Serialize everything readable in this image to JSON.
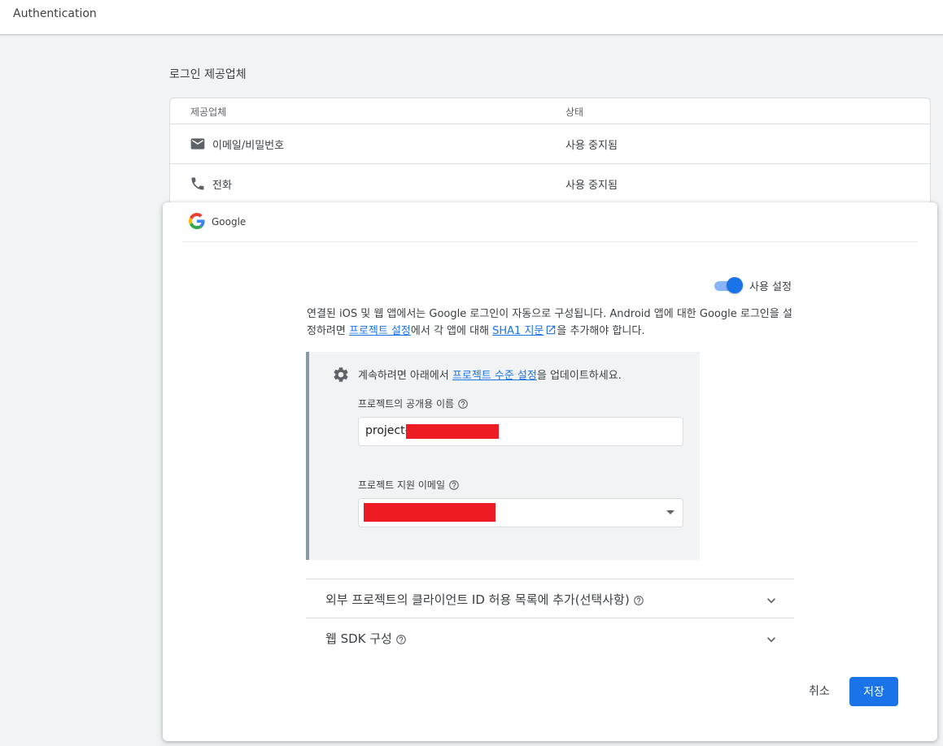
{
  "topbar": {
    "title": "Authentication"
  },
  "section": {
    "title": "로그인 제공업체"
  },
  "providers": {
    "headers": {
      "provider": "제공업체",
      "status": "상태"
    },
    "rows": [
      {
        "icon": "mail-icon",
        "name": "이메일/비밀번호",
        "status": "사용 중지됨"
      },
      {
        "icon": "phone-icon",
        "name": "전화",
        "status": "사용 중지됨"
      }
    ]
  },
  "panel": {
    "title": "Google",
    "toggle": {
      "label": "사용 설정",
      "enabled": true
    },
    "description": {
      "text1": "연결된 iOS 및 웹 앱에서는 Google 로그인이 자동으로 구성됩니다. Android 앱에 대한 Google 로그인을 설정하려면 ",
      "link1": "프로젝트 설정",
      "text2": "에서 각 앱에 대해 ",
      "link2": "SHA1 지문",
      "text3": "을 추가해야 합니다."
    },
    "info": {
      "text1": "계속하려면 아래에서 ",
      "link": "프로젝트 수준 설정",
      "text2": "을 업데이트하세요.",
      "public_name_label": "프로젝트의 공개용 이름",
      "public_name_value": "project-",
      "support_email_label": "프로젝트 지원 이메일"
    },
    "accordions": [
      {
        "label": "외부 프로젝트의 클라이언트 ID 허용 목록에 추가(선택사항)"
      },
      {
        "label": "웹 SDK 구성"
      }
    ],
    "actions": {
      "cancel": "취소",
      "save": "저장"
    }
  },
  "colors": {
    "primary": "#1a73e8",
    "toggle_track": "#8ab4f8",
    "redaction": "#ed1c24",
    "info_border": "#8c9aa6"
  }
}
